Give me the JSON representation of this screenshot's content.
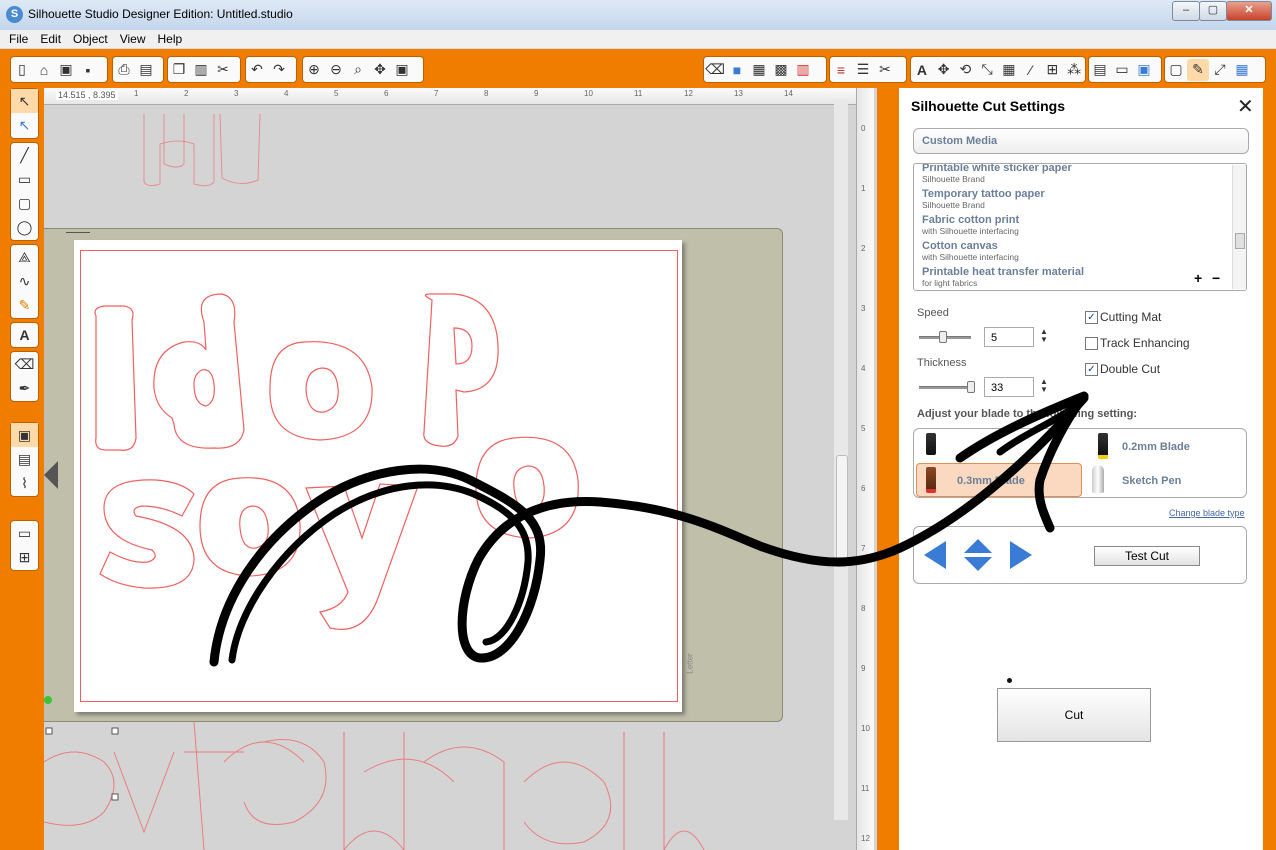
{
  "window": {
    "app_letter": "S",
    "title": "Silhouette Studio Designer Edition: Untitled.studio",
    "minimize": "–",
    "maximize": "▢",
    "close": "✕"
  },
  "menu": [
    "File",
    "Edit",
    "Object",
    "View",
    "Help"
  ],
  "canvas": {
    "coordinates": "14.515 , 8.395",
    "ruler_top": [
      "1",
      "2",
      "3",
      "4",
      "5",
      "6",
      "7",
      "8",
      "9",
      "10",
      "11",
      "12",
      "13",
      "14"
    ],
    "ruler_right": [
      "0",
      "1",
      "2",
      "3",
      "4",
      "5",
      "6",
      "7",
      "8",
      "9",
      "10",
      "11",
      "12"
    ],
    "mat_label": "Letter"
  },
  "panel": {
    "title": "Silhouette Cut Settings",
    "close": "✕",
    "media_selected": "Custom Media",
    "media_items": [
      {
        "name": "Printable white sticker paper",
        "sub": "Silhouette Brand"
      },
      {
        "name": "Temporary tattoo paper",
        "sub": "Silhouette Brand"
      },
      {
        "name": "Fabric cotton print",
        "sub": "with Silhouette interfacing"
      },
      {
        "name": "Cotton canvas",
        "sub": "with Silhouette interfacing"
      },
      {
        "name": "Printable heat transfer material",
        "sub": "for light fabrics"
      }
    ],
    "add": "+",
    "remove": "−",
    "speed_label": "Speed",
    "speed_value": "5",
    "thickness_label": "Thickness",
    "thickness_value": "33",
    "cutting_mat": "Cutting Mat",
    "track_enhancing": "Track Enhancing",
    "double_cut": "Double Cut",
    "blade_heading": "Adjust your blade to the following setting:",
    "blades": [
      "0.2mm Blade",
      "0.3mm Blade",
      "Sketch Pen"
    ],
    "change_blade": "Change blade type",
    "test_cut": "Test Cut",
    "cut": "Cut"
  },
  "colors": {
    "accent": "#f07d00",
    "outline": "#f06060",
    "scribble": "#000000"
  }
}
